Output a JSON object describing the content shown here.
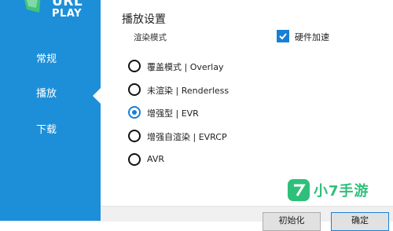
{
  "app": {
    "logo_line1": "URL",
    "logo_line2": "PLAY"
  },
  "sidebar": {
    "items": [
      {
        "label": "常规",
        "selected": false
      },
      {
        "label": "播放",
        "selected": true
      },
      {
        "label": "下载",
        "selected": false
      }
    ]
  },
  "settings": {
    "title": "播放设置",
    "render_mode_label": "渲染模式",
    "hardware_acceleration": {
      "label": "硬件加速",
      "checked": true
    },
    "render_options": [
      {
        "label": "覆盖模式 | Overlay",
        "selected": false
      },
      {
        "label": "未渲染 | Renderless",
        "selected": false
      },
      {
        "label": "增强型 | EVR",
        "selected": true
      },
      {
        "label": "增强自渲染 | EVRCP",
        "selected": false
      },
      {
        "label": "AVR",
        "selected": false
      }
    ]
  },
  "footer": {
    "reset_label": "初始化",
    "ok_label": "确定"
  },
  "watermark": {
    "text": "小7手游"
  },
  "colors": {
    "sidebar": "#1c8fd8",
    "accent": "#1a7fd4",
    "watermark": "#2fbf7a"
  }
}
